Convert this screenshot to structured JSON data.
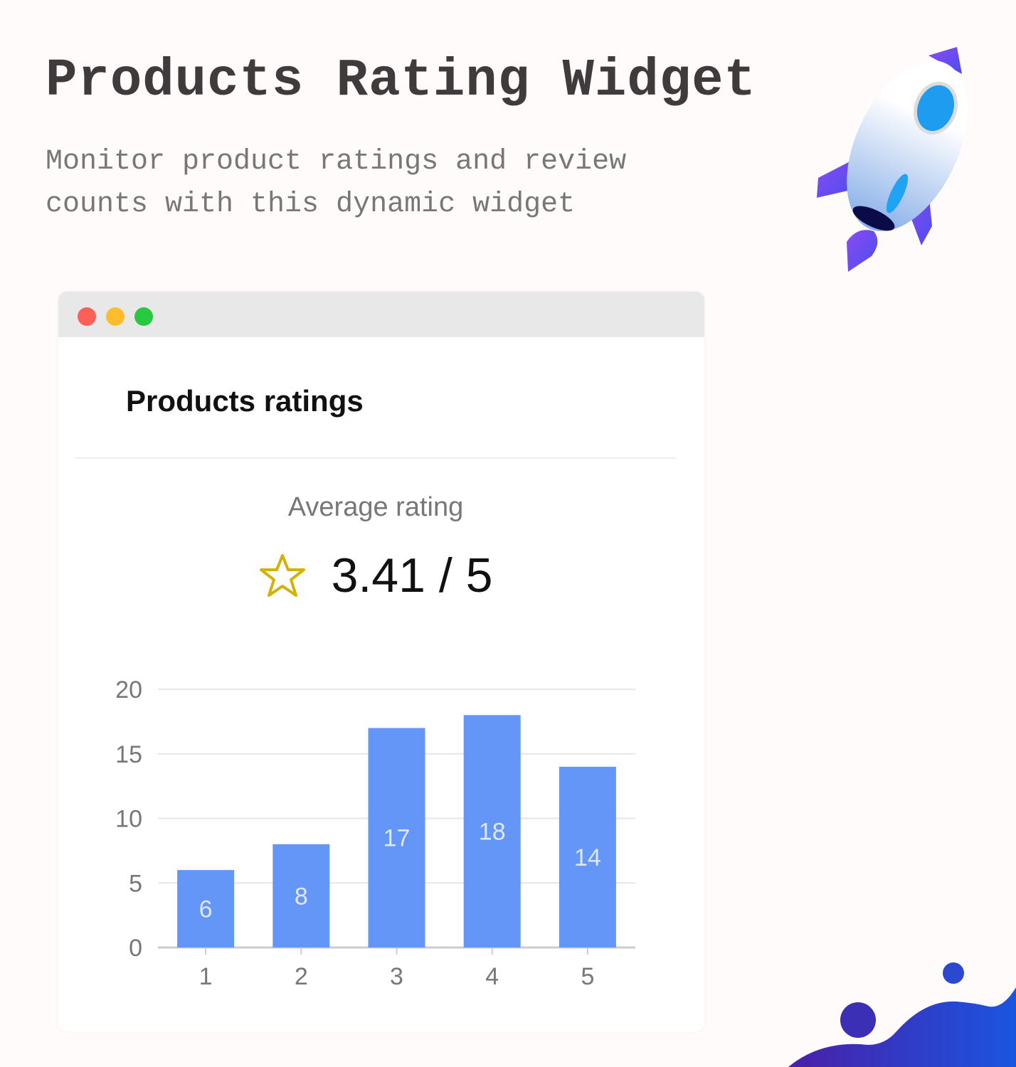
{
  "header": {
    "title": "Products Rating Widget",
    "subtitle": "Monitor product ratings and review counts with this dynamic widget"
  },
  "window": {
    "controls": [
      {
        "name": "close",
        "color": "#fe5f57"
      },
      {
        "name": "minimize",
        "color": "#febc2e"
      },
      {
        "name": "maximize",
        "color": "#28c840"
      }
    ]
  },
  "widget": {
    "title": "Products ratings",
    "average_label": "Average rating",
    "average_value": "3.41 / 5",
    "star_icon": "star-outline-icon",
    "star_color": "#d4b106"
  },
  "chart_data": {
    "type": "bar",
    "categories": [
      "1",
      "2",
      "3",
      "4",
      "5"
    ],
    "values": [
      6,
      8,
      17,
      18,
      14
    ],
    "ylim": [
      0,
      20
    ],
    "yticks": [
      0,
      5,
      10,
      15,
      20
    ],
    "grid": true,
    "data_labels": true,
    "bar_color": "#6496f8",
    "xlabel": "",
    "ylabel": ""
  },
  "decor": {
    "rocket_icon": "rocket-icon",
    "wave_colors": [
      "#4a1fa8",
      "#1a55e0"
    ]
  }
}
